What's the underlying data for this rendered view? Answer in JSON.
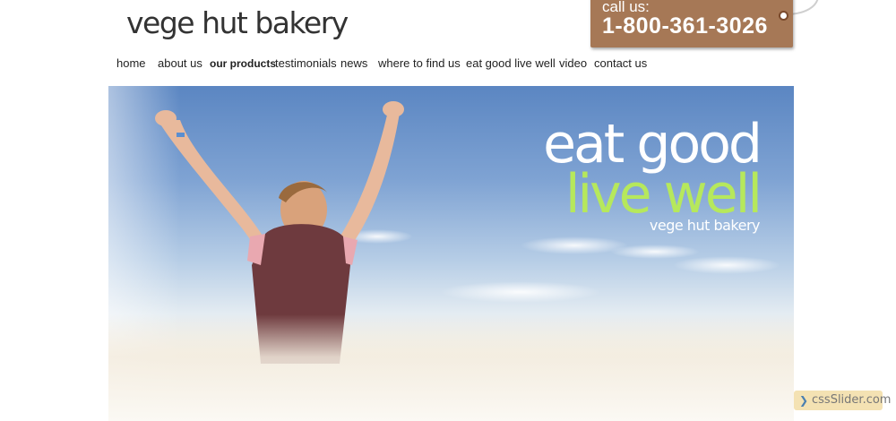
{
  "brand": {
    "name": "vege hut bakery"
  },
  "callout": {
    "label": "call us:",
    "phone": "1-800-361-3026"
  },
  "nav": {
    "items": [
      {
        "label": "home"
      },
      {
        "label": "about us"
      },
      {
        "label": "our products"
      },
      {
        "label": "testimonials"
      },
      {
        "label": "news"
      },
      {
        "label": "where to find us"
      },
      {
        "label": "eat good live well"
      },
      {
        "label": "video"
      },
      {
        "label": "contact us"
      }
    ],
    "active_index": 2
  },
  "hero": {
    "line1": "eat good",
    "line2": "live well",
    "line3": "vege hut bakery"
  },
  "slider_badge": {
    "label": "cssSlider.com"
  },
  "colors": {
    "tag": "#a67856",
    "headline_accent": "#b6e85c",
    "sky_top": "#5b86c2",
    "field": "#f7f3ea"
  }
}
